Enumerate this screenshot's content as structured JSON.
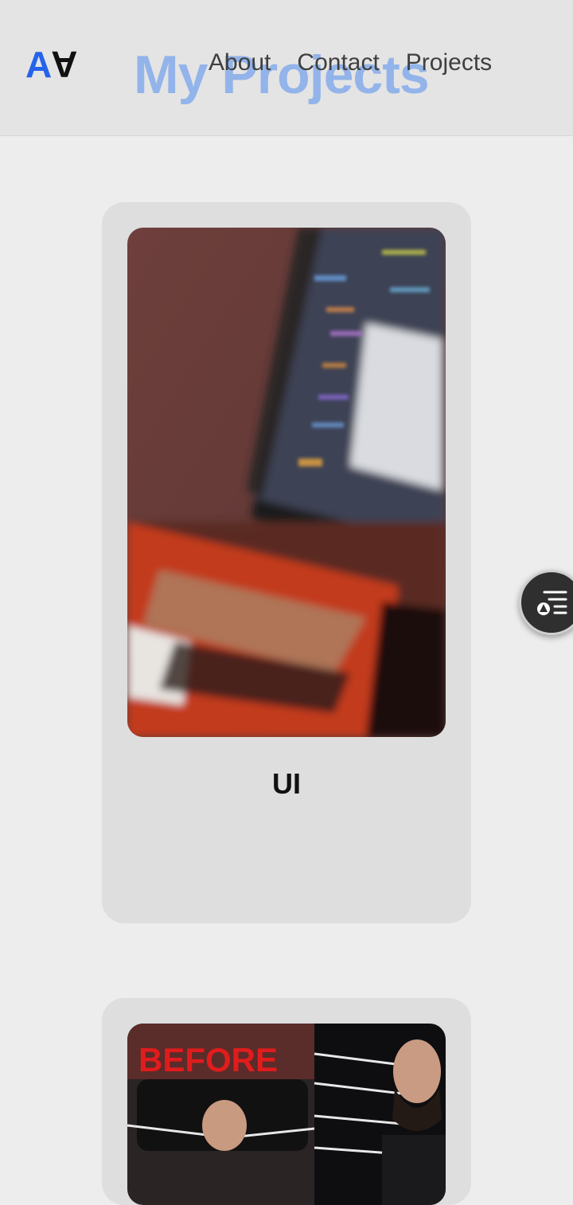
{
  "header": {
    "logo": {
      "left": "A",
      "right": "A"
    },
    "title": "My Projects",
    "nav": [
      "About",
      "Contact",
      "Projects"
    ]
  },
  "projects": [
    {
      "title": "UI"
    },
    {
      "title": "",
      "thumbnail_text": "BEFORE"
    }
  ],
  "floating_button": {
    "icon": "menu-list-icon"
  },
  "colors": {
    "accent": "#2563eb",
    "title": "#93b4ea",
    "background": "#ededed",
    "card": "#dedede"
  }
}
